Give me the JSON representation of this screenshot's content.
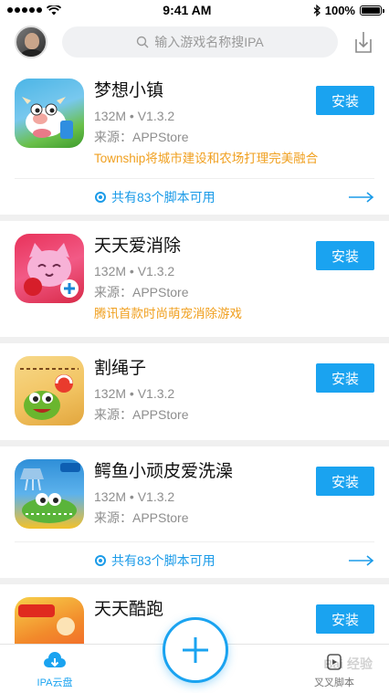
{
  "status": {
    "time": "9:41 AM",
    "battery": "100%"
  },
  "header": {
    "search_placeholder": "输入游戏名称搜IPA"
  },
  "apps": [
    {
      "name": "梦想小镇",
      "size": "132M",
      "version": "V1.3.2",
      "source": "来源：APPStore",
      "desc": "Township将城市建设和农场打理完美融合",
      "install": "安装",
      "scripts": "共有83个脚本可用",
      "icon_colors": [
        "#4bb5e6",
        "#6ac04a"
      ]
    },
    {
      "name": "天天爱消除",
      "size": "132M",
      "version": "V1.3.2",
      "source": "来源：APPStore",
      "desc": "腾讯首款时尚萌宠消除游戏",
      "install": "安装",
      "icon_colors": [
        "#e8325a",
        "#f7b2d7"
      ]
    },
    {
      "name": "割绳子",
      "size": "132M",
      "version": "V1.3.2",
      "source": "来源：APPStore",
      "install": "安装",
      "icon_colors": [
        "#f2c462",
        "#6ab62e"
      ]
    },
    {
      "name": "鳄鱼小顽皮爱洗澡",
      "size": "132M",
      "version": "V1.3.2",
      "source": "来源：APPStore",
      "install": "安装",
      "scripts": "共有83个脚本可用",
      "icon_colors": [
        "#2f8fd8",
        "#f3c12a"
      ]
    },
    {
      "name": "天天酷跑",
      "install": "安装",
      "icon_colors": [
        "#f15a2b",
        "#f7d04a"
      ]
    }
  ],
  "tabs": [
    {
      "label": "IPA云盘"
    },
    {
      "label": "叉叉脚本"
    }
  ],
  "watermark": "Bai 经验",
  "colors": {
    "accent": "#1aa3f0",
    "desc": "#f0a020"
  }
}
